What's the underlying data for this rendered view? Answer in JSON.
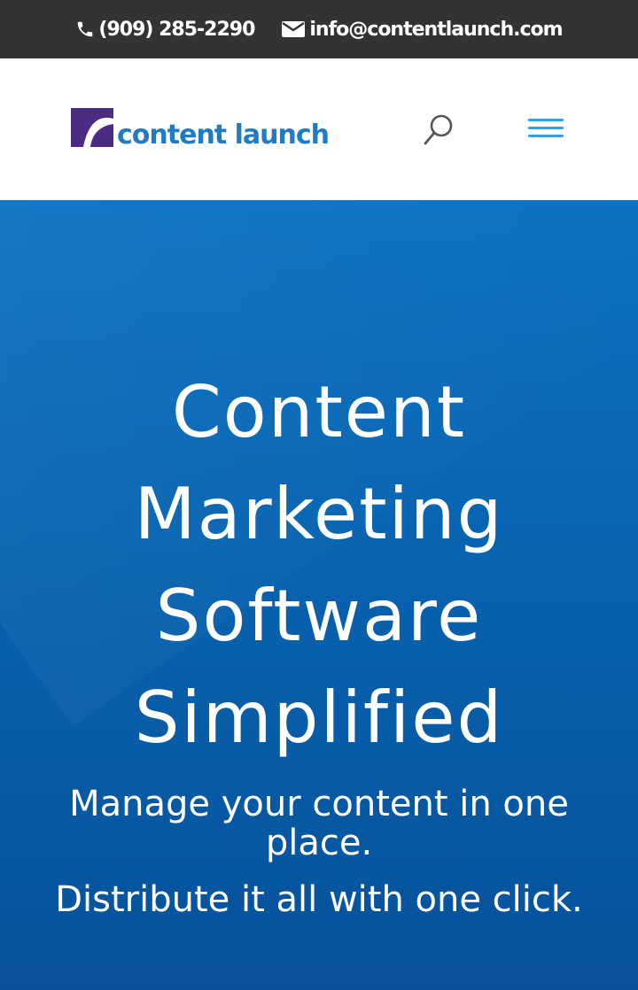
{
  "topbar": {
    "phone": "(909) 285-2290",
    "email": "info@contentlaunch.com",
    "phone_icon": "phone-icon",
    "email_icon": "envelope-icon",
    "background": "#333333"
  },
  "header": {
    "logo_text": "content launch",
    "logo_icon": "content-launch-mark-icon",
    "search_icon": "search-icon",
    "menu_icon": "hamburger-menu-icon",
    "accent": "#2ea3f2",
    "logo_purple": "#4a2d83",
    "logo_blue": "#1f7cc4"
  },
  "hero": {
    "title_lines": [
      "Content",
      "Marketing",
      "Software",
      "Simplified"
    ],
    "subtitle_1": "Manage your content in one place.",
    "subtitle_2": "Distribute it all with one click.",
    "background": "#0863b0"
  }
}
